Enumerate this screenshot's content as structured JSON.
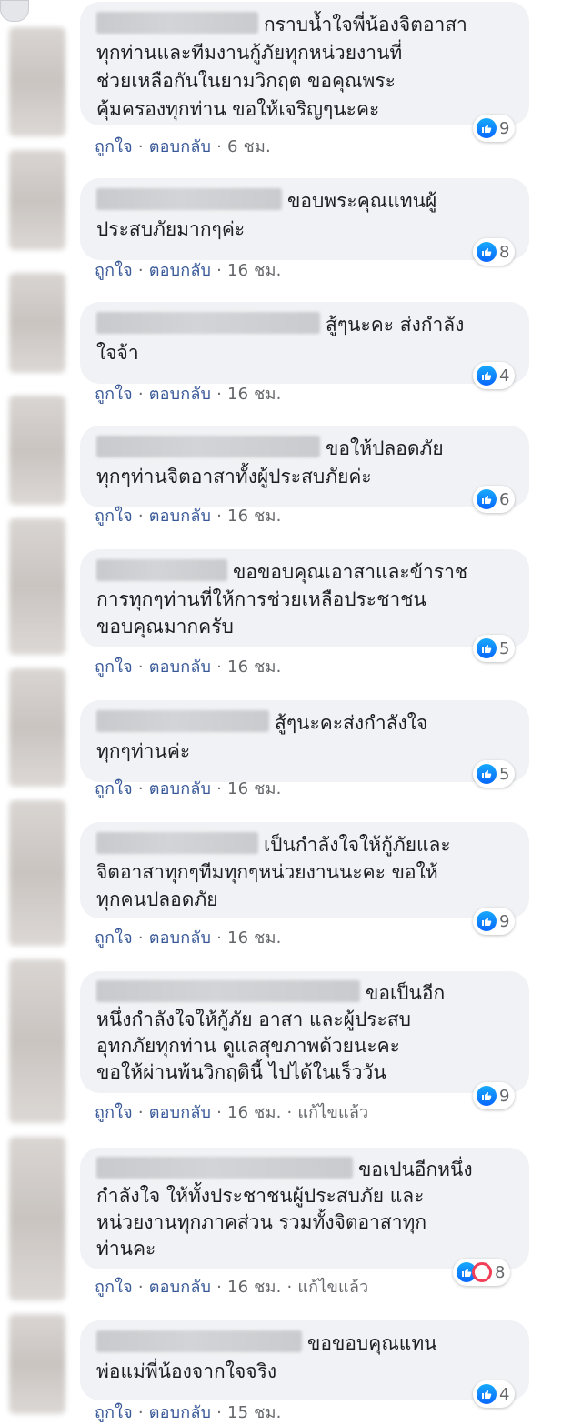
{
  "action_like": "ถูกใจ",
  "action_reply": "ตอบกลับ",
  "separator": "·",
  "colors": {
    "bubble": "#f0f2f5",
    "link": "#385898",
    "like_blue": "#0866ff",
    "love_red": "#f33e58"
  },
  "comments": [
    {
      "text": "กราบน้ำใจพี่น้องจิตอาสา\nทุกท่านและทีมงานกู้ภัยทุกหน่วยงานที่\nช่วยเหลือกันในยามวิกฤต ขอคุณพระ\nคุ้มครองทุกท่าน ขอให้เจริญๆนะคะ",
      "time": "6 ชม.",
      "reactions": "9",
      "edited": ""
    },
    {
      "text": "ขอบพระคุณแทนผู้\nประสบภัยมากๆค่ะ",
      "time": "16 ชม.",
      "reactions": "8",
      "edited": ""
    },
    {
      "text": "สู้ๆนะคะ ส่งกำลัง\nใจจ้า",
      "time": "16 ชม.",
      "reactions": "4",
      "edited": ""
    },
    {
      "text": "ขอให้ปลอดภัย\nทุกๆท่านจิตอาสาทั้งผู้ประสบภัยค่ะ",
      "time": "16 ชม.",
      "reactions": "6",
      "edited": ""
    },
    {
      "text": "ขอขอบคุณเอาสาและข้าราช\nการทุกๆท่านที่ให้การช่วยเหลือประชาชน\nขอบคุณมากครับ",
      "time": "16 ชม.",
      "reactions": "5",
      "edited": ""
    },
    {
      "text": "สู้ๆนะคะส่งกำลังใจ\nทุกๆท่านค่ะ",
      "time": "16 ชม.",
      "reactions": "5",
      "edited": ""
    },
    {
      "text": "เป็นกำลังใจให้กู้ภัยและ\nจิตอาสาทุกๆทีมทุกๆหน่วยงานนะคะ ขอให้\nทุกคนปลอดภัย",
      "time": "16 ชม.",
      "reactions": "9",
      "edited": ""
    },
    {
      "text": "ขอเป็นอีก\nหนึ่งกำลังใจให้กู้ภัย อาสา และผู้ประสบ\nอุทกภัยทุกท่าน ดูแลสุขภาพด้วยนะคะ\nขอให้ผ่านพ้นวิกฤตินี้ ไปได้ในเร็ววัน",
      "time": "16 ชม.",
      "reactions": "9",
      "edited": "แก้ไขแล้ว"
    },
    {
      "text": "ขอเปนอีกหนึ่ง\nกำลังใจ ให้ทั้งประชาชนผู้ประสบภัย และ\nหน่วยงานทุกภาคส่วน รวมทั้งจิตอาสาทุก\nท่านคะ",
      "time": "16 ชม.",
      "reactions": "8",
      "edited": "แก้ไขแล้ว"
    },
    {
      "text": "ขอขอบคุณแทน\nพ่อแม่พี่น้องจากใจจริง",
      "time": "15 ชม.",
      "reactions": "4",
      "edited": ""
    }
  ]
}
